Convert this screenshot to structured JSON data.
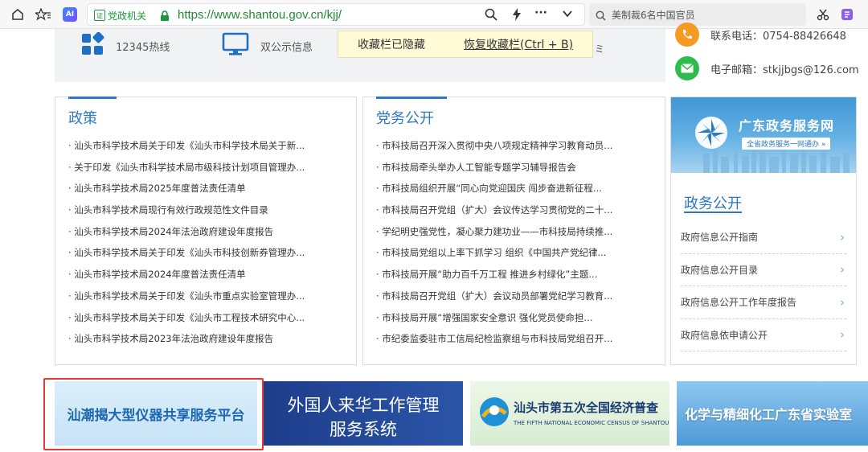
{
  "browser": {
    "cert_label": "党政机关",
    "url_scheme": "https://",
    "url_host": "www.shantou.gov.cn",
    "url_path": "/kjj/",
    "search_text": "美制裁6名中国官员",
    "ai_label": "AI"
  },
  "topbar": {
    "hotline_label": "12345热线",
    "office_label": "双公示信息",
    "toast_hidden": "收藏栏已隐藏",
    "toast_restore": "恢复收藏栏(Ctrl + B)",
    "toast_tail": "ミ",
    "phone": "联系电话：0754-88426648",
    "email": "电子邮箱：stkjjbgs@126.com"
  },
  "policy": {
    "title": "政策",
    "items": [
      "· 汕头市科学技术局关于印发《汕头市科学技术局关于新...",
      "· 关于印发《汕头市科学技术局市级科技计划项目管理办...",
      "· 汕头市科学技术局2025年度普法责任清单",
      "· 汕头市科学技术局现行有效行政规范性文件目录",
      "· 汕头市科学技术局2024年法治政府建设年度报告",
      "· 汕头市科学技术局关于印发《汕头市科技创新券管理办...",
      "· 汕头市科学技术局2024年度普法责任清单",
      "· 汕头市科学技术局关于印发《汕头市重点实验室管理办...",
      "· 汕头市科学技术局关于印发《汕头市工程技术研究中心...",
      "· 汕头市科学技术局2023年法治政府建设年度报告"
    ]
  },
  "party": {
    "title": "党务公开",
    "items": [
      "· 市科技局召开深入贯彻中央八项规定精神学习教育动员...",
      "· 市科技局牵头举办人工智能专题学习辅导报告会",
      "· 市科技局组织开展“同心向党迎国庆 闯步奋进新征程...",
      "· 市科技局召开党组（扩大）会议传达学习贯彻党的二十...",
      "· 学纪明史强党性，凝心聚力建功业——市科技局持续推...",
      "· 市科技局党组以上率下抓学习 组织《中国共产党纪律...",
      "· 市科技局开展“助力百千万工程 推进乡村绿化”主题...",
      "· 市科技局召开党组（扩大）会议动员部署党纪学习教育...",
      "· 市科技局开展“增强国家安全意识 强化党员使命担...",
      "· 市纪委监委驻市工信局纪检监察组与市科技局党组召开..."
    ]
  },
  "govservice": {
    "banner_title": "广东政务服务网",
    "banner_sub": "全省政务服务一网通办 »",
    "title": "政务公开",
    "items": [
      "政府信息公开指南",
      "政府信息公开目录",
      "政府信息公开工作年度报告",
      "政府信息依申请公开"
    ],
    "arrow": "›"
  },
  "banners": {
    "instrument": "汕潮揭大型仪器共享服务平台",
    "foreign_line1": "外国人来华工作管理",
    "foreign_line2": "服务系统",
    "census_cn": "汕头市第五次全国经济普查",
    "census_en": "THE FIFTH NATIONAL ECONOMIC CENSUS OF SHANTOU",
    "chem": "化学与精细化工广东省实验室"
  },
  "colors": {
    "accent": "#2d77c4",
    "highlight": "#e53935",
    "url_green": "#1f8a34"
  }
}
